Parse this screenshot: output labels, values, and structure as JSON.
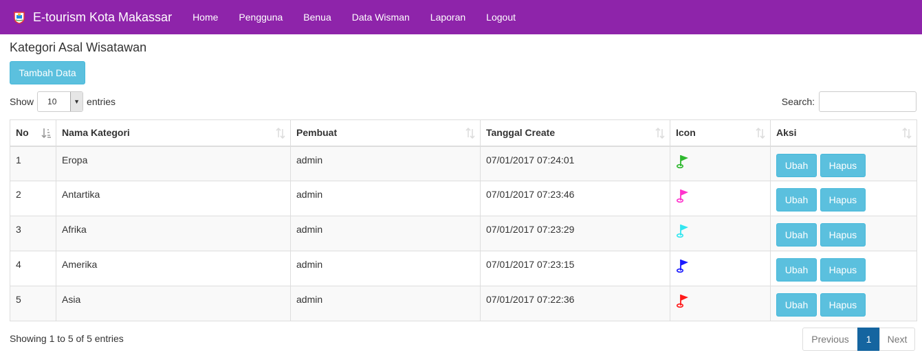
{
  "nav": {
    "brand": "E-tourism Kota Makassar",
    "links": [
      "Home",
      "Pengguna",
      "Benua",
      "Data Wisman",
      "Laporan",
      "Logout"
    ]
  },
  "page": {
    "title": "Kategori Asal Wisatawan",
    "add_button": "Tambah Data"
  },
  "length": {
    "show_label": "Show",
    "value": "10",
    "entries_label": "entries"
  },
  "search": {
    "label": "Search:",
    "value": ""
  },
  "table": {
    "headers": [
      "No",
      "Nama Kategori",
      "Pembuat",
      "Tanggal Create",
      "Icon",
      "Aksi"
    ],
    "rows": [
      {
        "no": "1",
        "nama": "Eropa",
        "pembuat": "admin",
        "tanggal": "07/01/2017 07:24:01",
        "icon": "flag-icon",
        "color": "#2eb82e"
      },
      {
        "no": "2",
        "nama": "Antartika",
        "pembuat": "admin",
        "tanggal": "07/01/2017 07:23:46",
        "icon": "flag-icon",
        "color": "#ff33cc"
      },
      {
        "no": "3",
        "nama": "Afrika",
        "pembuat": "admin",
        "tanggal": "07/01/2017 07:23:29",
        "icon": "flag-icon",
        "color": "#33e6f0"
      },
      {
        "no": "4",
        "nama": "Amerika",
        "pembuat": "admin",
        "tanggal": "07/01/2017 07:23:15",
        "icon": "flag-icon",
        "color": "#1a1aff"
      },
      {
        "no": "5",
        "nama": "Asia",
        "pembuat": "admin",
        "tanggal": "07/01/2017 07:22:36",
        "icon": "flag-icon",
        "color": "#ff1a1a"
      }
    ],
    "edit_label": "Ubah",
    "delete_label": "Hapus"
  },
  "footer": {
    "info": "Showing 1 to 5 of 5 entries",
    "previous": "Previous",
    "current": "1",
    "next": "Next"
  },
  "colors": {
    "navbar": "#8e24aa",
    "button": "#5bc0de",
    "active_page": "#1565a0"
  }
}
